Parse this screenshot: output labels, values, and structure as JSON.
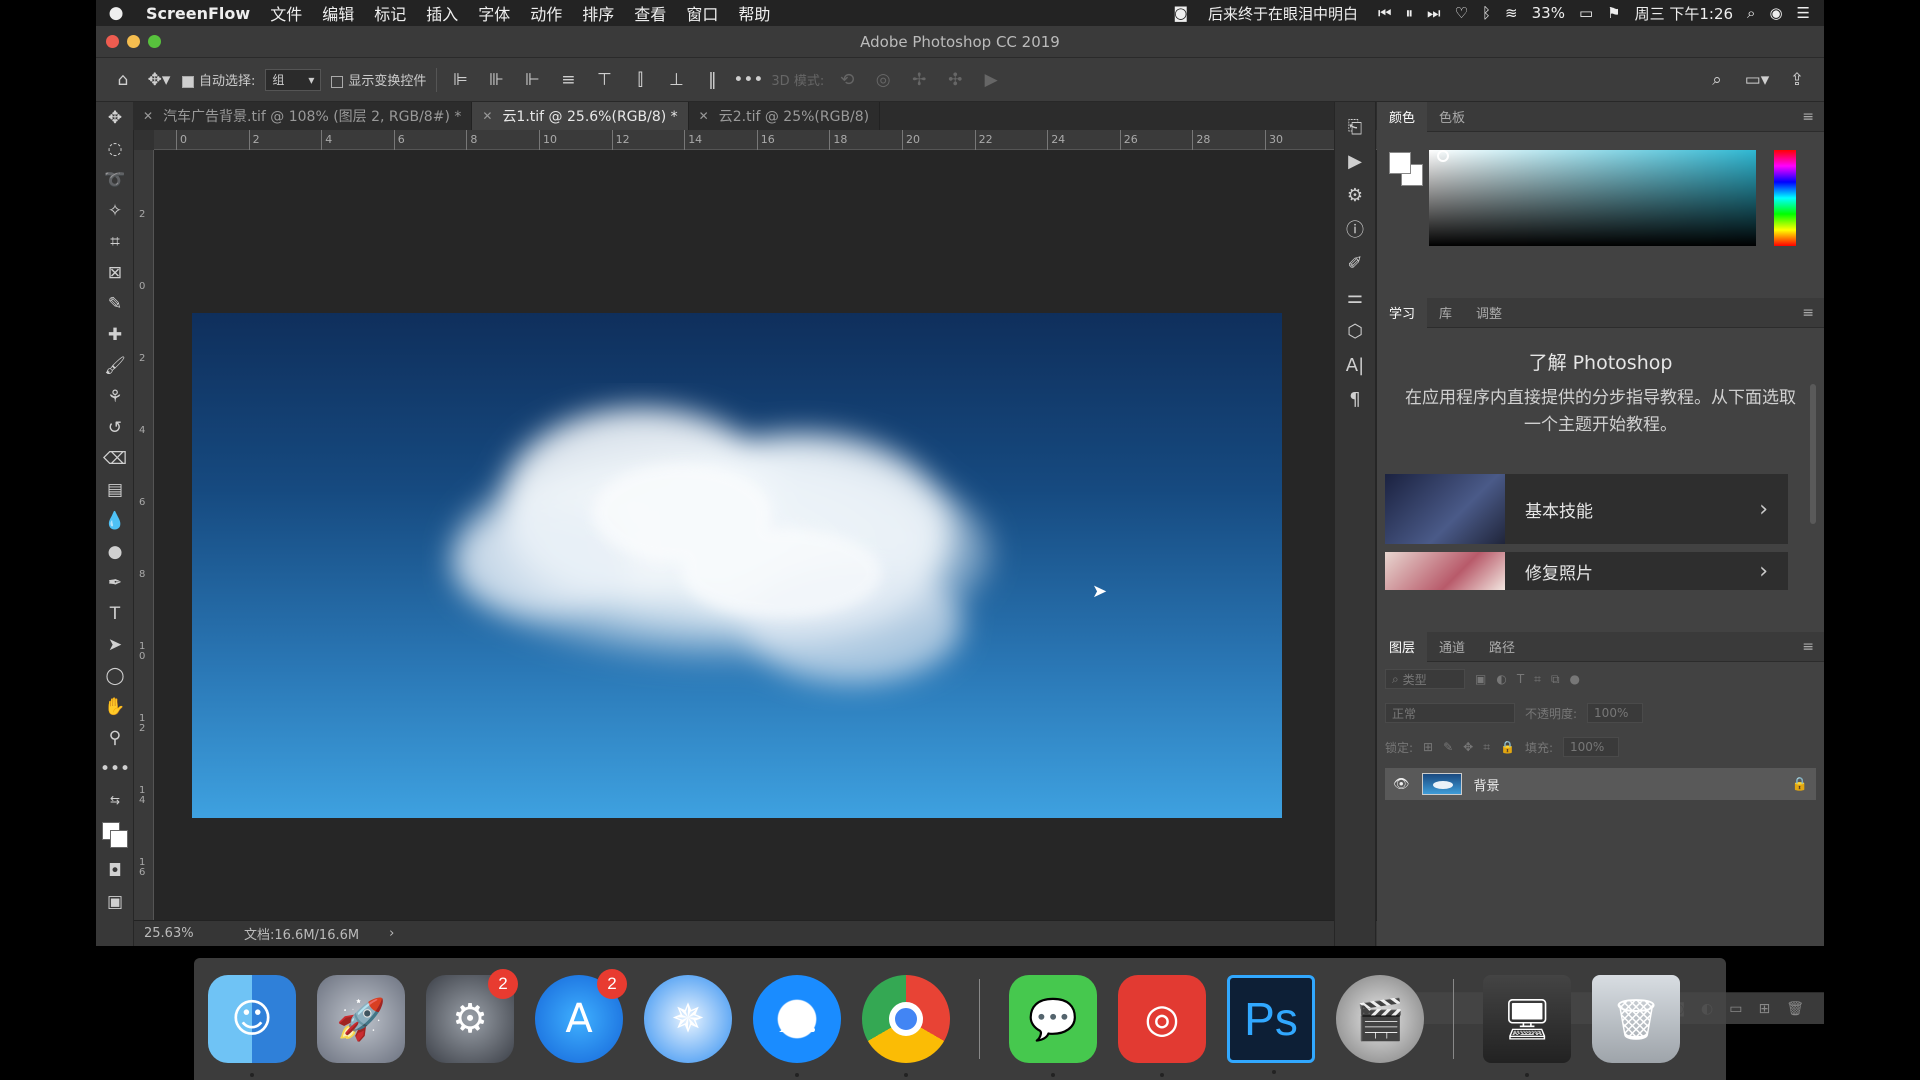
{
  "menubar": {
    "app_name": "ScreenFlow",
    "items": [
      "文件",
      "编辑",
      "标记",
      "插入",
      "字体",
      "动作",
      "排序",
      "查看",
      "窗口",
      "帮助"
    ],
    "song": "后来终于在眼泪中明白",
    "battery": "33%",
    "datetime": "周三 下午1:26"
  },
  "window": {
    "title": "Adobe Photoshop CC 2019"
  },
  "options": {
    "auto_select_label": "自动选择:",
    "auto_select_value": "组",
    "show_transform_label": "显示变换控件",
    "mode_3d_label": "3D 模式:"
  },
  "tabs": [
    {
      "label": "汽车广告背景.tif @ 108% (图层 2, RGB/8#) *"
    },
    {
      "label": "云1.tif @ 25.6%(RGB/8) *"
    },
    {
      "label": "云2.tif @ 25%(RGB/8)"
    }
  ],
  "ruler": {
    "top_ticks": [
      "0",
      "2",
      "4",
      "6",
      "8",
      "10",
      "12",
      "14",
      "16",
      "18",
      "20",
      "22",
      "24",
      "26",
      "28",
      "30"
    ],
    "left_ticks": [
      "2",
      "0",
      "2",
      "4",
      "6",
      "8",
      "1 0",
      "1 2",
      "1 4",
      "1 6"
    ]
  },
  "status": {
    "zoom": "25.63%",
    "doc": "文档:16.6M/16.6M",
    "arrow": "›"
  },
  "color_panel": {
    "tabs": [
      "颜色",
      "色板"
    ]
  },
  "learn_panel": {
    "tabs": [
      "学习",
      "库",
      "调整"
    ],
    "title": "了解 Photoshop",
    "description": "在应用程序内直接提供的分步指导教程。从下面选取一个主题开始教程。",
    "cards": [
      {
        "label": "基本技能"
      },
      {
        "label": "修复照片"
      }
    ]
  },
  "layers_panel": {
    "tabs": [
      "图层",
      "通道",
      "路径"
    ],
    "filter_label": "类型",
    "blend_mode": "正常",
    "opacity_label": "不透明度:",
    "opacity_value": "100%",
    "lock_label": "锁定:",
    "fill_label": "填充:",
    "fill_value": "100%",
    "layers": [
      {
        "name": "背景"
      }
    ]
  },
  "dock": {
    "apps": [
      {
        "name": "Finder"
      },
      {
        "name": "Launchpad"
      },
      {
        "name": "System Preferences",
        "badge": "2"
      },
      {
        "name": "App Store",
        "badge": "2"
      },
      {
        "name": "Safari"
      },
      {
        "name": "QQ Browser"
      },
      {
        "name": "Chrome"
      },
      {
        "name": "WeChat"
      },
      {
        "name": "NetEase Music"
      },
      {
        "name": "Photoshop",
        "text": "Ps"
      },
      {
        "name": "Final Cut"
      },
      {
        "name": "Screen Flow"
      },
      {
        "name": "Trash"
      }
    ]
  }
}
